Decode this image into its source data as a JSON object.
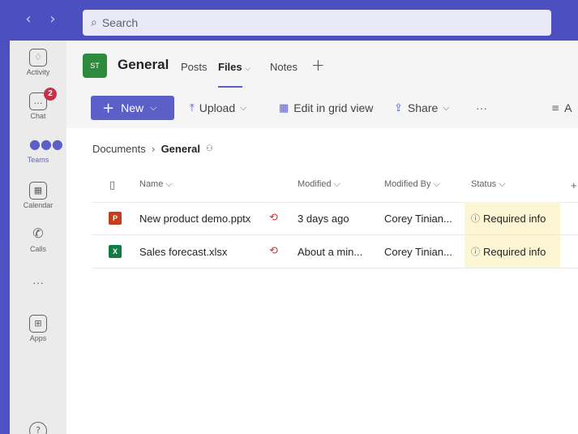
{
  "nav": {
    "back": "‹",
    "forward": "›"
  },
  "search": {
    "placeholder": "Search"
  },
  "rail": {
    "items": [
      {
        "label": "Activity",
        "icon": "bell-icon",
        "glyph": "🔔"
      },
      {
        "label": "Chat",
        "icon": "chat-icon",
        "glyph": "…",
        "badge": "2"
      },
      {
        "label": "Teams",
        "icon": "teams-icon",
        "glyph": "👥"
      },
      {
        "label": "Calendar",
        "icon": "calendar-icon",
        "glyph": "▦"
      },
      {
        "label": "Calls",
        "icon": "phone-icon",
        "glyph": "✆"
      },
      {
        "label": "",
        "icon": "more-icon",
        "glyph": "···"
      },
      {
        "label": "Apps",
        "icon": "apps-icon",
        "glyph": "⊞"
      },
      {
        "label": "",
        "icon": "help-icon",
        "glyph": "?"
      }
    ]
  },
  "channel": {
    "avatar": "ST",
    "name": "General",
    "tabs": [
      "Posts",
      "Files",
      "Notes"
    ],
    "files_chevron": "⌵"
  },
  "toolbar": {
    "new_label": "New",
    "upload_label": "Upload",
    "grid_label": "Edit in grid view",
    "share_label": "Share",
    "more": "···",
    "cut_label": "A"
  },
  "breadcrumb": {
    "parent": "Documents",
    "current": "General"
  },
  "table": {
    "headers": [
      "Name",
      "Modified",
      "Modified By",
      "Status"
    ],
    "add_column": "+",
    "rows": [
      {
        "name": "New product demo.pptx",
        "type": "pptx",
        "modified": "3 days ago",
        "modified_by": "Corey Tinian...",
        "status": "Required info"
      },
      {
        "name": "Sales forecast.xlsx",
        "type": "xlsx",
        "modified": "About a min...",
        "modified_by": "Corey Tinian...",
        "status": "Required info"
      }
    ]
  },
  "colors": {
    "accent": "#5b5fc7",
    "ppt": "#c43e1c",
    "xls": "#107c41",
    "status_bg": "#fdf6d5",
    "badge": "#c4314b"
  }
}
